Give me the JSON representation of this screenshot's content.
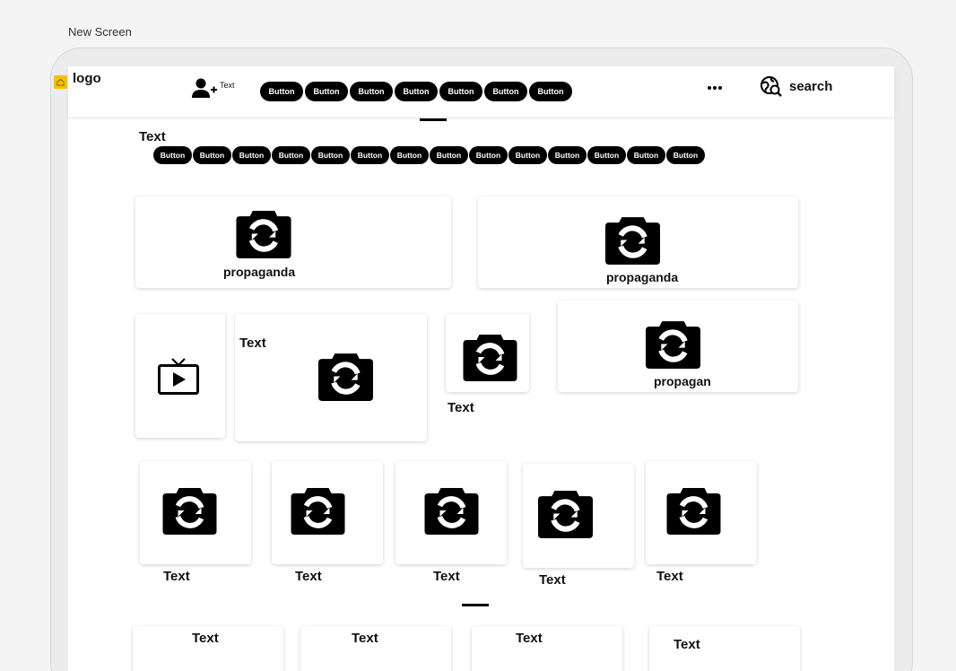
{
  "screen_title": "New Screen",
  "header": {
    "logo_text": "logo",
    "user_add_text": "Text",
    "buttons": [
      "Button",
      "Button",
      "Button",
      "Button",
      "Button",
      "Button",
      "Button"
    ],
    "search_label": "search",
    "accent_color": "#f5c000"
  },
  "section_top": {
    "title": "Text",
    "buttons": [
      "Button",
      "Button",
      "Button",
      "Button",
      "Button",
      "Button",
      "Button",
      "Button",
      "Button",
      "Button",
      "Button",
      "Button",
      "Button",
      "Button"
    ]
  },
  "row1": [
    {
      "caption": "propaganda"
    },
    {
      "caption": "propaganda"
    }
  ],
  "row2": {
    "tv_icon": "live-tv-icon",
    "card2_text": "Text",
    "card3_text": "Text",
    "card4_caption": "propagan"
  },
  "row3": [
    "Text",
    "Text",
    "Text",
    "Text",
    "Text"
  ],
  "row4": [
    "Text",
    "Text",
    "Text",
    "Text"
  ],
  "icons": {
    "camera": "camera-switch-icon",
    "user_add": "person-add-icon",
    "more": "more-horizontal-icon",
    "search": "travel-explore-icon"
  }
}
